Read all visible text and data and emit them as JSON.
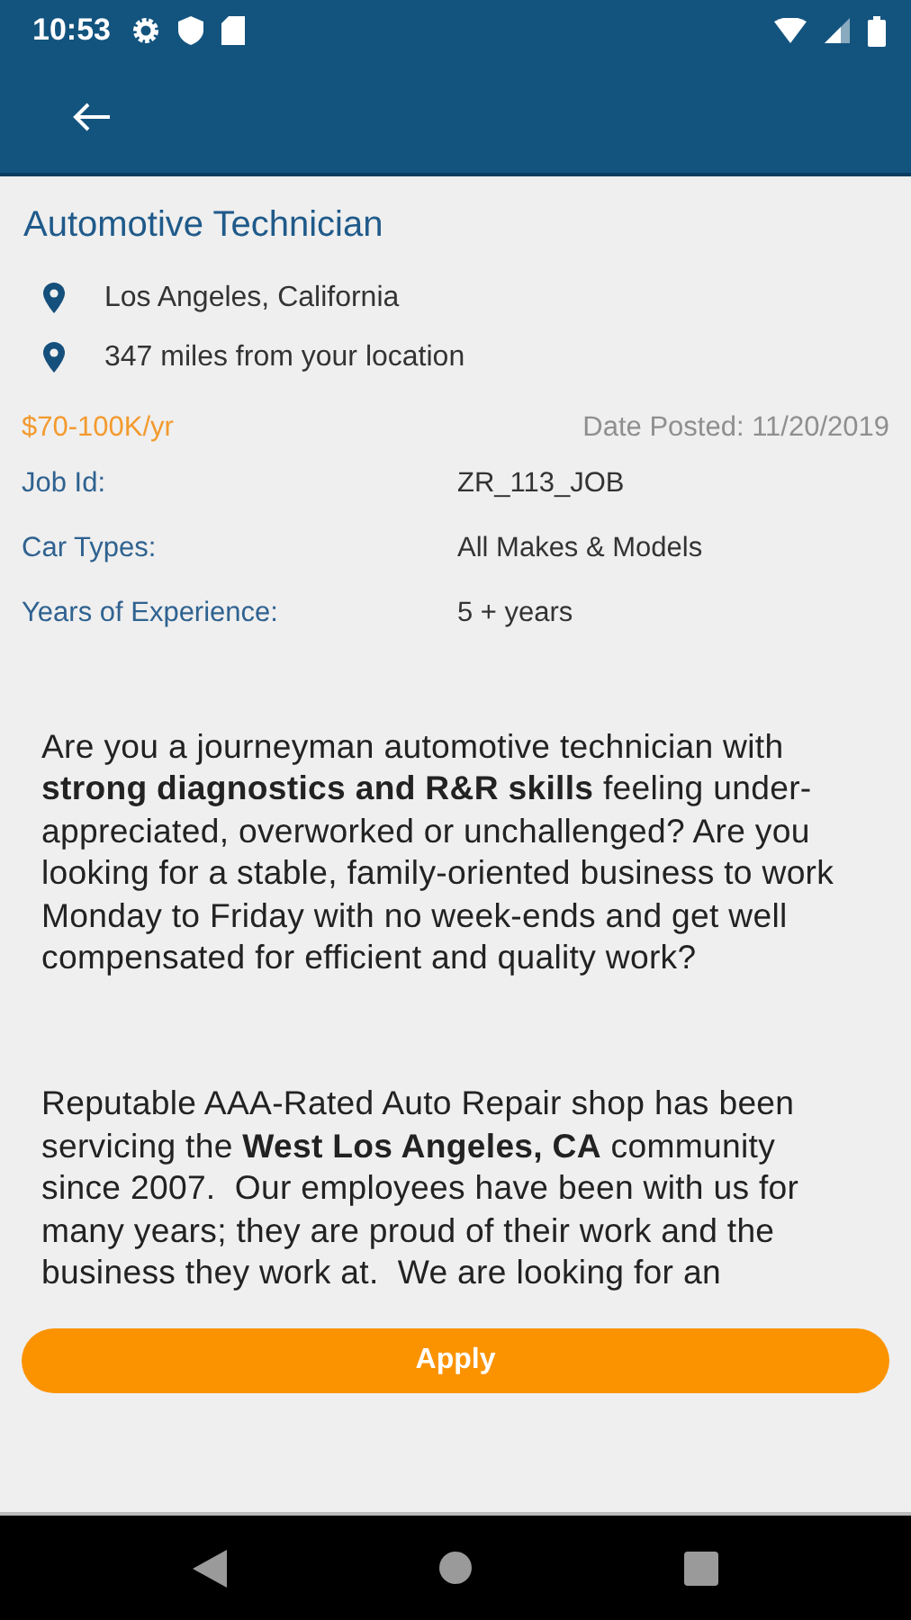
{
  "status_bar": {
    "time": "10:53"
  },
  "job": {
    "title": "Automotive Technician",
    "locations": [
      {
        "text": "Los Angeles, California"
      },
      {
        "text": "347 miles from your location"
      }
    ],
    "salary": "$70-100K/yr",
    "date_posted": "Date Posted: 11/20/2019",
    "details": [
      {
        "label": "Job Id:",
        "value": "ZR_113_JOB"
      },
      {
        "label": "Car Types:",
        "value": "All Makes & Models"
      },
      {
        "label": "Years of Experience:",
        "value": "5 + years"
      }
    ],
    "description": [
      "Are you a journeyman automotive technician with **strong diagnostics and R&R skills** feeling under-appreciated, overworked or unchallenged? Are you looking for a stable, family-oriented business to work Monday to Friday with no week-ends and get well compensated for efficient and quality work?",
      "Reputable AAA-Rated Auto Repair shop has been servicing the **West Los Angeles, CA** community since 2007.  Our employees have been with us for many years; they are proud of their work and the business they work at.  We are looking for an"
    ]
  },
  "apply_button": "Apply"
}
